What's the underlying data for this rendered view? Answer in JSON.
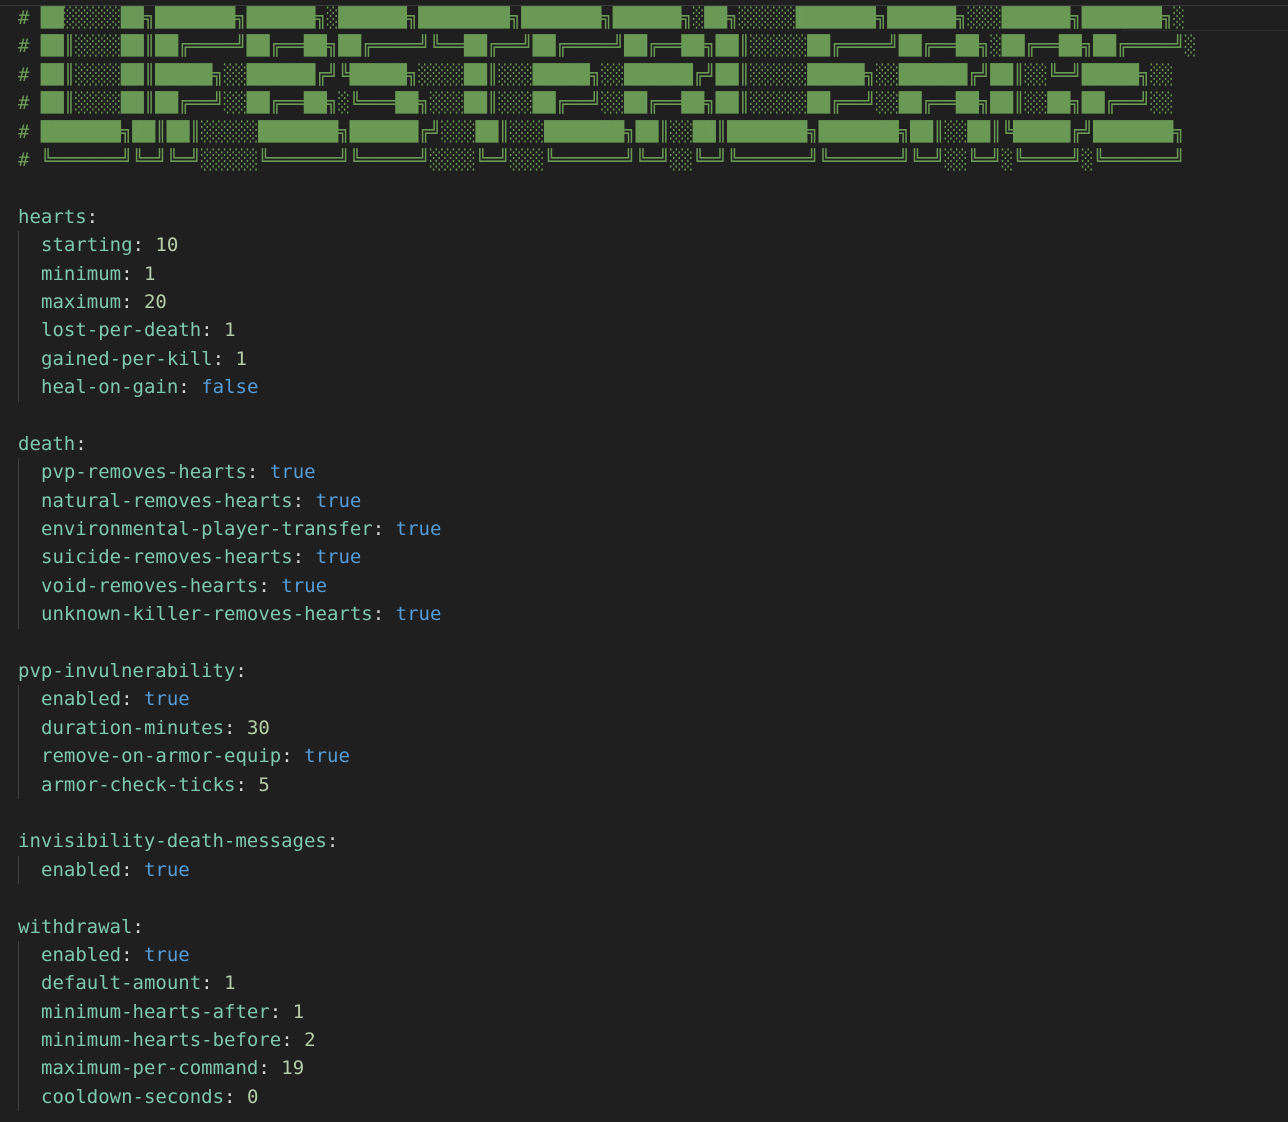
{
  "banner": {
    "comment_marker": "#",
    "lines": [
      "██░░░░░██╗███████╗██████╗░██████╗████████╗███████╗██████╗░██╗░░░░░███████╗██████╗░░░██████╗███████╗░",
      "██║░░░░██║██╔════╝██╔══██╗██╔════╝╚══██╔══╝██╔════╝██╔══██╗██║░░░░░██╔════╝██╔══██╗░██╔══██╗██╔════╝░",
      "██║░░░░██║█████╗░░██████╔╝╚█████╗░░░░██║░░░█████╗░░██████╔╝██║░░░░░█████╗░░██████╔╝██║░░╚═╝█████╗░░",
      "██║░░░░██║██╔══╝░░██╔══██╗░╚═══██╗░░░██║░░░██╔══╝░░██╔══██╗██║░░░░░██╔══╝░░██╔══██╗██║░░██╗██╔══╝░░",
      "███████╗██║██║░░░░░███████╗██████╔╝░░░██║░░░███████╗██║░░██║███████╗███████╗██║░░██║╚█████╔╝███████╗",
      "╚══════╝╚═╝╚═╝░░░░░╚══════╝╚═════╝░░░░╚═╝░░░╚══════╝╚═╝░░╚═╝╚══════╝╚══════╝╚═╝░░╚═╝░╚════╝░╚══════╝"
    ]
  },
  "config": {
    "colon": ":",
    "sections": [
      {
        "key": "hearts",
        "entries": [
          {
            "key": "starting",
            "value": "10",
            "type": "num"
          },
          {
            "key": "minimum",
            "value": "1",
            "type": "num"
          },
          {
            "key": "maximum",
            "value": "20",
            "type": "num"
          },
          {
            "key": "lost-per-death",
            "value": "1",
            "type": "num"
          },
          {
            "key": "gained-per-kill",
            "value": "1",
            "type": "num"
          },
          {
            "key": "heal-on-gain",
            "value": "false",
            "type": "bool"
          }
        ]
      },
      {
        "key": "death",
        "entries": [
          {
            "key": "pvp-removes-hearts",
            "value": "true",
            "type": "bool"
          },
          {
            "key": "natural-removes-hearts",
            "value": "true",
            "type": "bool"
          },
          {
            "key": "environmental-player-transfer",
            "value": "true",
            "type": "bool"
          },
          {
            "key": "suicide-removes-hearts",
            "value": "true",
            "type": "bool"
          },
          {
            "key": "void-removes-hearts",
            "value": "true",
            "type": "bool"
          },
          {
            "key": "unknown-killer-removes-hearts",
            "value": "true",
            "type": "bool"
          }
        ]
      },
      {
        "key": "pvp-invulnerability",
        "entries": [
          {
            "key": "enabled",
            "value": "true",
            "type": "bool"
          },
          {
            "key": "duration-minutes",
            "value": "30",
            "type": "num"
          },
          {
            "key": "remove-on-armor-equip",
            "value": "true",
            "type": "bool"
          },
          {
            "key": "armor-check-ticks",
            "value": "5",
            "type": "num"
          }
        ]
      },
      {
        "key": "invisibility-death-messages",
        "entries": [
          {
            "key": "enabled",
            "value": "true",
            "type": "bool"
          }
        ]
      },
      {
        "key": "withdrawal",
        "entries": [
          {
            "key": "enabled",
            "value": "true",
            "type": "bool"
          },
          {
            "key": "default-amount",
            "value": "1",
            "type": "num"
          },
          {
            "key": "minimum-hearts-after",
            "value": "1",
            "type": "num"
          },
          {
            "key": "minimum-hearts-before",
            "value": "2",
            "type": "num"
          },
          {
            "key": "maximum-per-command",
            "value": "19",
            "type": "num"
          },
          {
            "key": "cooldown-seconds",
            "value": "0",
            "type": "num"
          }
        ]
      }
    ]
  },
  "colors": {
    "background": "#1f1f1f",
    "comment": "#6a9955",
    "key": "#7fc8b0",
    "number": "#b5cea8",
    "boolean": "#569cd6"
  }
}
